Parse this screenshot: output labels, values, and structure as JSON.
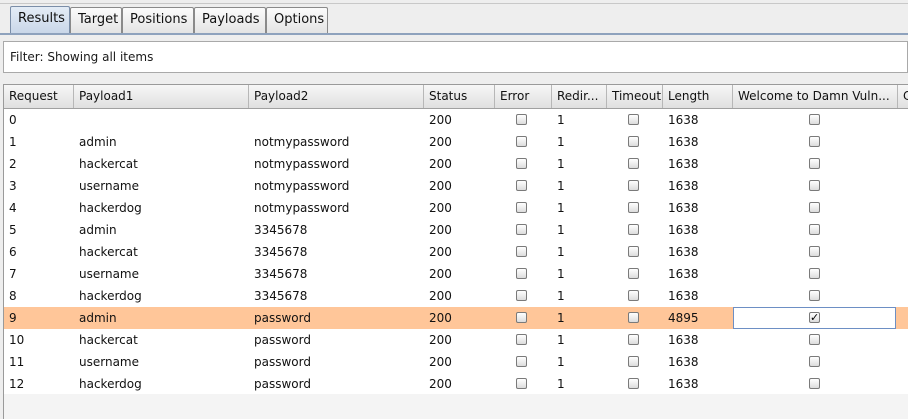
{
  "tabs": [
    {
      "label": "Results",
      "active": true
    },
    {
      "label": "Target"
    },
    {
      "label": "Positions"
    },
    {
      "label": "Payloads"
    },
    {
      "label": "Options"
    }
  ],
  "filter": {
    "text": "Filter: Showing all items"
  },
  "table": {
    "headers": [
      "Request",
      "Payload1",
      "Payload2",
      "Status",
      "Error",
      "Redir...",
      "Timeout",
      "Length",
      "Welcome to Damn Vuln...",
      "C"
    ],
    "rows": [
      {
        "request": "0",
        "payload1": "",
        "payload2": "",
        "status": "200",
        "redir": "1",
        "length": "1638",
        "welcome": false
      },
      {
        "request": "1",
        "payload1": "admin",
        "payload2": "notmypassword",
        "status": "200",
        "redir": "1",
        "length": "1638",
        "welcome": false
      },
      {
        "request": "2",
        "payload1": "hackercat",
        "payload2": "notmypassword",
        "status": "200",
        "redir": "1",
        "length": "1638",
        "welcome": false
      },
      {
        "request": "3",
        "payload1": "username",
        "payload2": "notmypassword",
        "status": "200",
        "redir": "1",
        "length": "1638",
        "welcome": false
      },
      {
        "request": "4",
        "payload1": "hackerdog",
        "payload2": "notmypassword",
        "status": "200",
        "redir": "1",
        "length": "1638",
        "welcome": false
      },
      {
        "request": "5",
        "payload1": "admin",
        "payload2": "3345678",
        "status": "200",
        "redir": "1",
        "length": "1638",
        "welcome": false
      },
      {
        "request": "6",
        "payload1": "hackercat",
        "payload2": "3345678",
        "status": "200",
        "redir": "1",
        "length": "1638",
        "welcome": false
      },
      {
        "request": "7",
        "payload1": "username",
        "payload2": "3345678",
        "status": "200",
        "redir": "1",
        "length": "1638",
        "welcome": false
      },
      {
        "request": "8",
        "payload1": "hackerdog",
        "payload2": "3345678",
        "status": "200",
        "redir": "1",
        "length": "1638",
        "welcome": false
      },
      {
        "request": "9",
        "payload1": "admin",
        "payload2": "password",
        "status": "200",
        "redir": "1",
        "length": "4895",
        "welcome": true,
        "selected": true
      },
      {
        "request": "10",
        "payload1": "hackercat",
        "payload2": "password",
        "status": "200",
        "redir": "1",
        "length": "1638",
        "welcome": false
      },
      {
        "request": "11",
        "payload1": "username",
        "payload2": "password",
        "status": "200",
        "redir": "1",
        "length": "1638",
        "welcome": false
      },
      {
        "request": "12",
        "payload1": "hackerdog",
        "payload2": "password",
        "status": "200",
        "redir": "1",
        "length": "1638",
        "welcome": false
      }
    ]
  },
  "colors": {
    "selected_row": "#ffc699",
    "tab_active": "#c9d6e8"
  }
}
